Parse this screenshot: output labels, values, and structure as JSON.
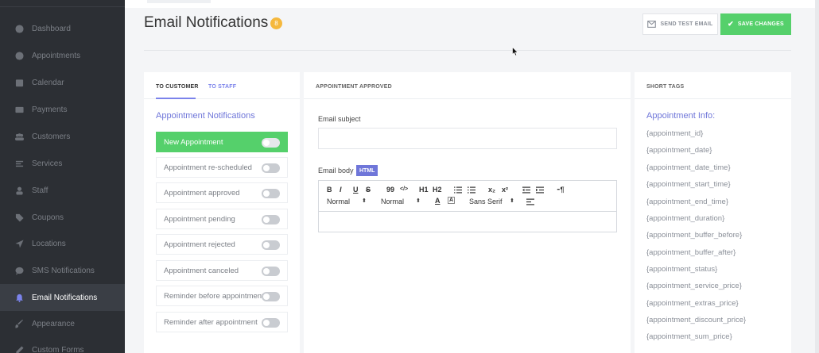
{
  "sidebar": {
    "items": [
      {
        "label": "Dashboard",
        "icon": "dashboard-icon"
      },
      {
        "label": "Appointments",
        "icon": "clock-icon"
      },
      {
        "label": "Calendar",
        "icon": "calendar-icon"
      },
      {
        "label": "Payments",
        "icon": "credit-card-icon"
      },
      {
        "label": "Customers",
        "icon": "users-icon"
      },
      {
        "label": "Services",
        "icon": "list-icon"
      },
      {
        "label": "Staff",
        "icon": "user-icon"
      },
      {
        "label": "Coupons",
        "icon": "tag-icon"
      },
      {
        "label": "Locations",
        "icon": "location-arrow-icon"
      },
      {
        "label": "SMS Notifications",
        "icon": "chat-bubble-icon"
      },
      {
        "label": "Email Notifications",
        "icon": "bell-icon",
        "active": true
      },
      {
        "label": "Appearance",
        "icon": "brush-icon"
      },
      {
        "label": "Custom Forms",
        "icon": "pencil-icon"
      }
    ]
  },
  "header": {
    "title": "Email Notifications",
    "count": "8",
    "send_test_label": "SEND TEST EMAIL",
    "save_label": "SAVE CHANGES"
  },
  "left_panel": {
    "tabs": [
      "TO CUSTOMER",
      "TO STAFF"
    ],
    "active_tab": "TO CUSTOMER",
    "section_title": "Appointment Notifications",
    "notifications": [
      {
        "label": "New Appointment",
        "active": true,
        "enabled": false
      },
      {
        "label": "Appointment re-scheduled",
        "active": false,
        "enabled": false
      },
      {
        "label": "Appointment approved",
        "active": false,
        "enabled": false
      },
      {
        "label": "Appointment pending",
        "active": false,
        "enabled": false
      },
      {
        "label": "Appointment rejected",
        "active": false,
        "enabled": false
      },
      {
        "label": "Appointment canceled",
        "active": false,
        "enabled": false
      },
      {
        "label": "Reminder before appointment",
        "active": false,
        "enabled": false
      },
      {
        "label": "Reminder after appointment",
        "active": false,
        "enabled": false
      }
    ]
  },
  "middle_panel": {
    "header": "APPOINTMENT APPROVED",
    "subject_label": "Email subject",
    "subject_value": "",
    "body_label": "Email body",
    "html_badge": "HTML",
    "toolbar": {
      "bold": "B",
      "italic": "I",
      "underline": "U",
      "strike": "S",
      "quote": "99",
      "code": "</>",
      "h1": "H1",
      "h2": "H2",
      "ordered_list": "ordered-list-icon",
      "bullet_list": "bullet-list-icon",
      "subscript": "x₂",
      "superscript": "x²",
      "indent_left": "outdent-icon",
      "indent_right": "indent-icon",
      "rtl": "rtl-icon",
      "size_select": "Normal",
      "header_select": "Normal",
      "font_select": "Sans Serif"
    }
  },
  "right_panel": {
    "header": "SHORT TAGS",
    "section_title": "Appointment Info:",
    "tags": [
      "{appointment_id}",
      "{appointment_date}",
      "{appointment_date_time}",
      "{appointment_start_time}",
      "{appointment_end_time}",
      "{appointment_duration}",
      "{appointment_buffer_before}",
      "{appointment_buffer_after}",
      "{appointment_status}",
      "{appointment_service_price}",
      "{appointment_extras_price}",
      "{appointment_discount_price}",
      "{appointment_sum_price}"
    ]
  },
  "colors": {
    "accent": "#6f76d9",
    "success": "#55d06b",
    "badge": "#f5b83d",
    "sidebar": "#2c2f34"
  }
}
